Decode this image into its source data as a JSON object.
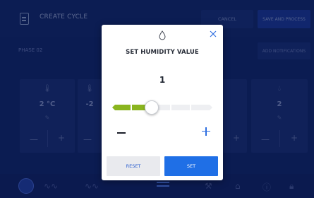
{
  "app": {
    "title": "CREATE CYCLE",
    "cancel_label": "CANCEL",
    "save_label": "SAVE AND PROCESS",
    "phase_label": "PHASE 02",
    "notifications_label": "ADD NOTIFICATIONS"
  },
  "cards": [
    {
      "icon": "thermometer-icon",
      "value": "2 °C"
    },
    {
      "icon": "thermometer-icon",
      "value": "-2"
    },
    {
      "icon": "drop-icon",
      "value": "2"
    }
  ],
  "modal": {
    "title": "SET HUMIDITY VALUE",
    "value": "1",
    "slider_level": 1,
    "slider_max": 5,
    "reset_label": "RESET",
    "set_label": "SET",
    "accent_color": "#8ab51f",
    "primary_color": "#1f6fe6"
  }
}
